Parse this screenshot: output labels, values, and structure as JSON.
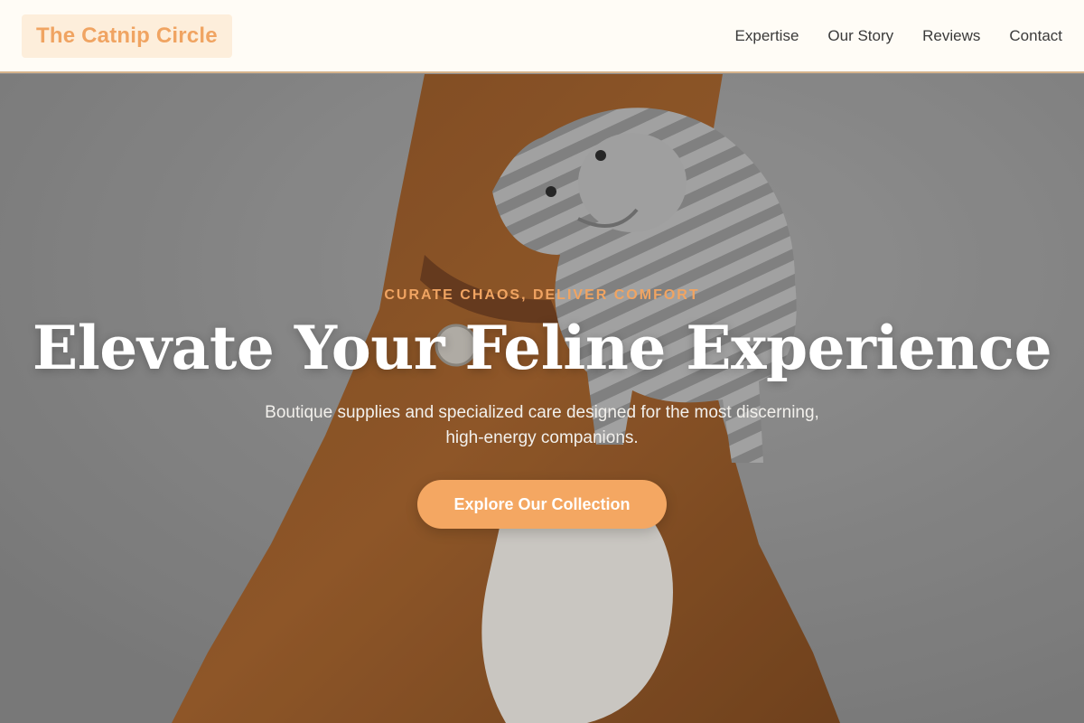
{
  "brand": {
    "name": "The Catnip Circle"
  },
  "nav": {
    "links": [
      "Expertise",
      "Our Story",
      "Reviews",
      "Contact"
    ]
  },
  "hero": {
    "eyebrow": "CURATE CHAOS, DELIVER COMFORT",
    "headline": "Elevate Your Feline Experience",
    "subheadline": "Boutique supplies and specialized care designed for the most discerning, high-energy companions.",
    "cta_label": "Explore Our Collection",
    "image": "dog holding knitted elephant plush toy"
  },
  "colors": {
    "accent": "#f4a762",
    "brand_bg": "#fdeedb",
    "nav_bg": "#fffcf6",
    "nav_border": "#d6b48c"
  }
}
